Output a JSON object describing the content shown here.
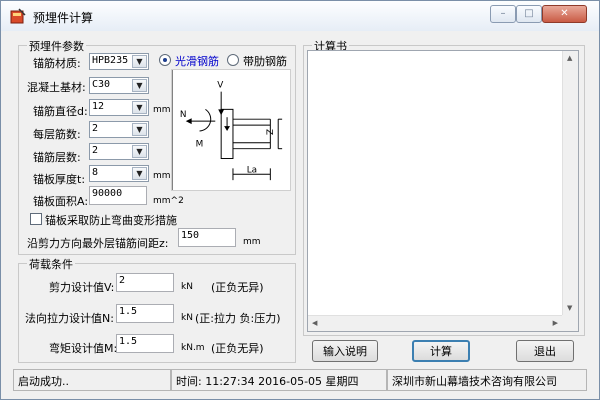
{
  "window": {
    "title": "预埋件计算",
    "min_glyph": "–",
    "max_glyph": "□",
    "close_glyph": "✕"
  },
  "params": {
    "legend": "预埋件参数",
    "anchor_material": {
      "label": "锚筋材质:",
      "value": "HPB235"
    },
    "concrete": {
      "label": "混凝土基材:",
      "value": "C30"
    },
    "anchor_diameter": {
      "label": "锚筋直径d:",
      "value": "12",
      "unit": "mm"
    },
    "bars_per_layer": {
      "label": "每层筋数:",
      "value": "2"
    },
    "layers": {
      "label": "锚筋层数:",
      "value": "2"
    },
    "plate_thickness": {
      "label": "锚板厚度t:",
      "value": "8",
      "unit": "mm"
    },
    "plate_area": {
      "label": "锚板面积A:",
      "value": "90000",
      "unit": "mm^2"
    },
    "radio_smooth": "光滑钢筋",
    "radio_ribbed": "带肋钢筋",
    "bend_checkbox": "锚板采取防止弯曲变形措施",
    "spacing": {
      "label": "沿剪力方向最外层锚筋间距z:",
      "value": "150",
      "unit": "mm"
    }
  },
  "diagram": {
    "V": "V",
    "N": "N",
    "M": "M",
    "Z": "Z",
    "La": "La"
  },
  "loads": {
    "legend": "荷载条件",
    "shear": {
      "label": "剪力设计值V:",
      "value": "2",
      "unit": "kN",
      "note": "(正负无异)"
    },
    "axial": {
      "label": "法向拉力设计值N:",
      "value": "1.5",
      "unit": "kN",
      "note": "(正:拉力 负:压力)"
    },
    "moment": {
      "label": "弯矩设计值M:",
      "value": "1.5",
      "unit": "kN.m",
      "note": "(正负无异)"
    }
  },
  "calc_book": {
    "legend": "计算书"
  },
  "buttons": {
    "input_help": "输入说明",
    "calculate": "计算",
    "exit": "退出"
  },
  "status": {
    "message": "启动成功..",
    "time": "时间: 11:27:34 2016-05-05 星期四",
    "company": "深圳市新山幕墙技术咨询有限公司"
  },
  "colors": {
    "radio_label": "#0000cc",
    "accent": "#3c7fb1"
  }
}
